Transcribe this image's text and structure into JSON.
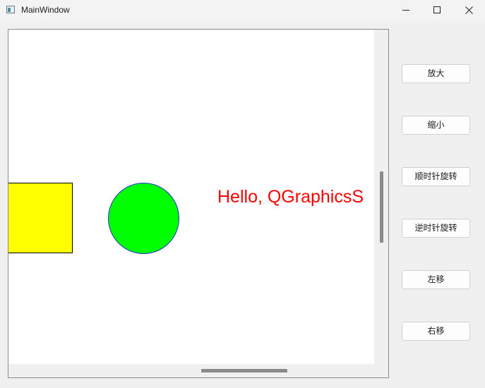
{
  "window": {
    "title": "MainWindow",
    "controls": [
      "minimize",
      "maximize",
      "close"
    ]
  },
  "scene": {
    "items": [
      {
        "kind": "rectangle",
        "fill": "#ffff00",
        "stroke": "#000000"
      },
      {
        "kind": "ellipse",
        "fill": "#00ff00",
        "stroke": "#1f2fd0"
      },
      {
        "kind": "text",
        "text": "Hello, QGraphicsS",
        "color": "#ff0000"
      }
    ]
  },
  "buttons": {
    "zoom_in": "放大",
    "zoom_out": "缩小",
    "rotate_cw": "顺时针旋转",
    "rotate_ccw": "逆时针旋转",
    "move_left": "左移",
    "move_right": "右移"
  }
}
